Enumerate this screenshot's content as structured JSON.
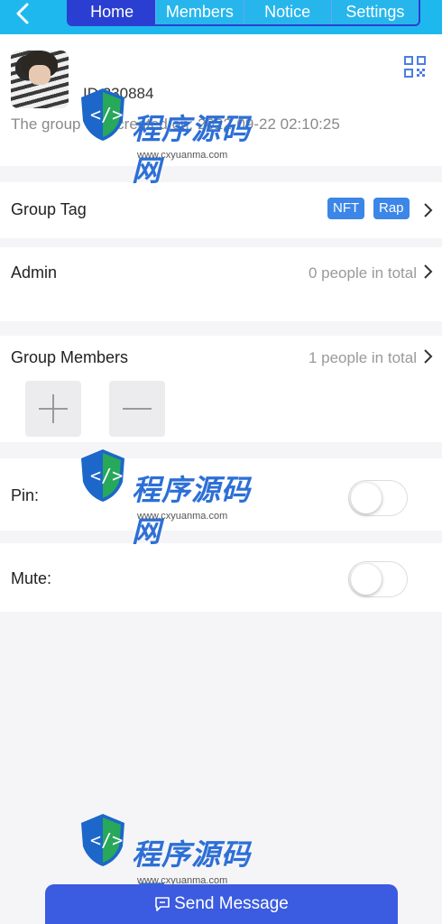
{
  "nav": {
    "tabs": [
      {
        "label": "Home",
        "active": true
      },
      {
        "label": "Members",
        "active": false
      },
      {
        "label": "Notice",
        "active": false
      },
      {
        "label": "Settings",
        "active": false
      }
    ]
  },
  "profile": {
    "group_id": "ID:330884",
    "created_text": "The group was created on: 2022-09-22 02:10:25"
  },
  "group_tag": {
    "label": "Group Tag",
    "tags": [
      "NFT",
      "Rap"
    ]
  },
  "admin": {
    "label": "Admin",
    "value": "0 people in total"
  },
  "members": {
    "label": "Group Members",
    "value": "1 people in total"
  },
  "pin": {
    "label": "Pin:",
    "on": false
  },
  "mute": {
    "label": "Mute:",
    "on": false
  },
  "watermark": {
    "title": "程序源码网",
    "url": "www.cxyuanma.com"
  },
  "send": {
    "label": "Send Message"
  },
  "colors": {
    "header": "#1fb8ee",
    "tab_active": "#2a3fd1",
    "tag": "#3c86e8",
    "send_button": "#3b5be0"
  }
}
